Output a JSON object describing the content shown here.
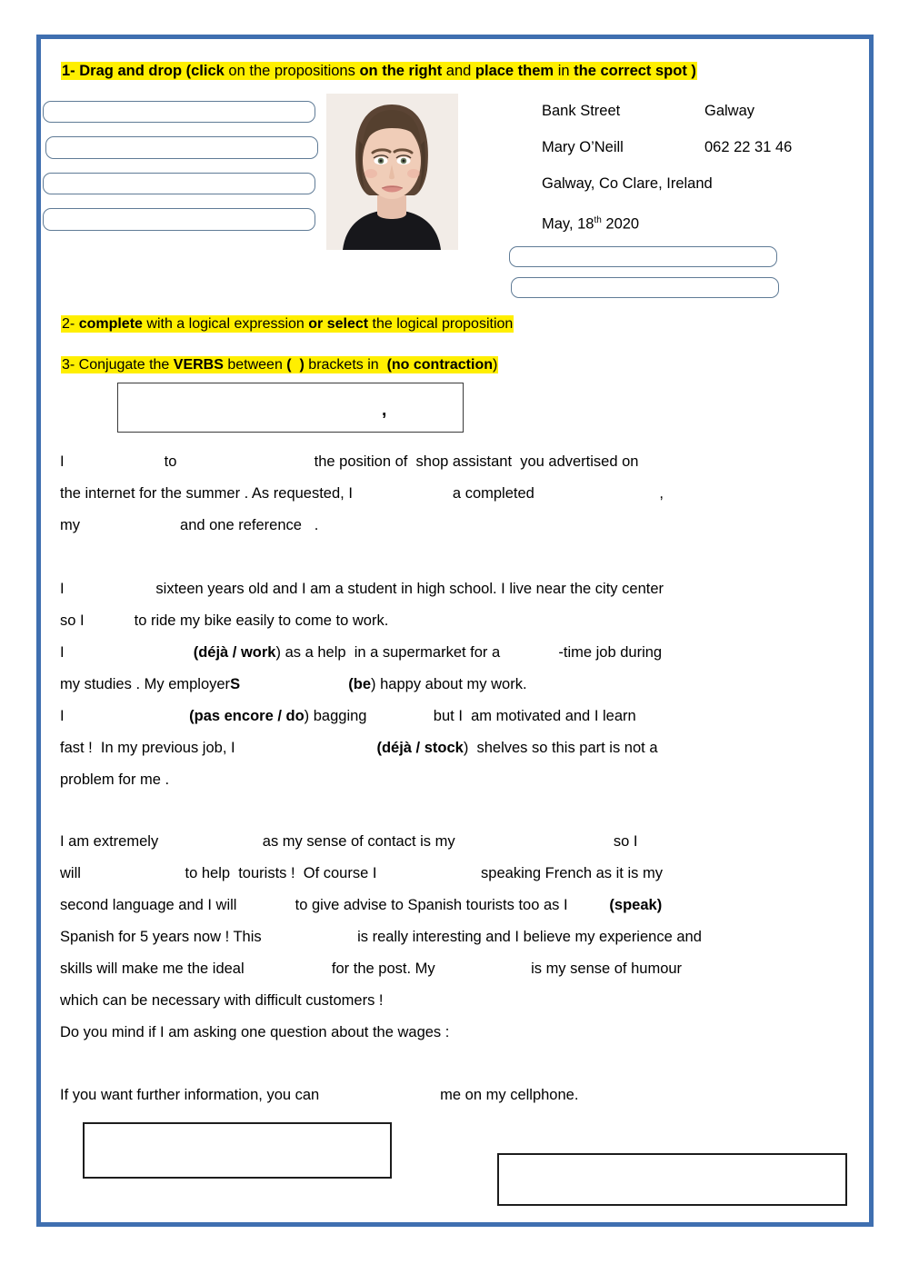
{
  "worksheet": {
    "frame_color": "#3f6fb0",
    "highlight_color": "#ffef00"
  },
  "instructions": {
    "line1": {
      "num": "1-",
      "p1_bold": "Drag and drop",
      "p2_bold": "(click",
      "p3": "on the propositions",
      "p4_bold": "on the right",
      "p5": "and",
      "p6_bold": "place them",
      "p7": "in",
      "p8_bold": "the correct spot )"
    },
    "line2": {
      "num": "2-",
      "p1_bold": "complete",
      "p2": "with a logical expression",
      "p3_bold": "or select",
      "p4": "the logical proposition"
    },
    "line3": {
      "num": "3- Conjugate the",
      "p1_bold": "VERBS",
      "p2": "between",
      "p3_bold": "(",
      "p4_bold": ")",
      "p5": "brackets in",
      "p6_bold": "(no contraction",
      "p7": ")"
    }
  },
  "dropzones": [
    {
      "id": "dz1",
      "value": ""
    },
    {
      "id": "dz2",
      "value": ""
    },
    {
      "id": "dz3",
      "value": ""
    },
    {
      "id": "dz4",
      "value": ""
    },
    {
      "id": "dz5",
      "value": ""
    },
    {
      "id": "dz6",
      "value": ""
    }
  ],
  "photo": {
    "alt": "passport-photo-of-young-woman"
  },
  "address": {
    "street": "Bank Street",
    "city": "Galway",
    "name": "Mary O’Neill",
    "phone": "062 22 31 46",
    "full_location": "Galway, Co Clare, Ireland",
    "date_prefix": "May, 18",
    "date_sup": "th",
    "date_year": " 2020"
  },
  "greeting": {
    "comma": ","
  },
  "letter": {
    "para1": [
      "I                        to                                 the position of  shop assistant  you advertised on",
      "the internet for the summer . As requested, I                        a completed                              ,",
      "my                        and one reference   ."
    ],
    "para2_line1": "I                      sixteen years old and I am a student in high school. I live near the city center",
    "para2_line2": "so I            to ride my bike easily to come to work.",
    "para2_line3_a": "I                               ",
    "para2_line3_cue": "(déjà / work",
    "para2_line3_b": ") as a help  in a supermarket for a              -time job during",
    "para2_line4_a": "my studies . My employer",
    "para2_line4_bold": "S",
    "para2_line4_b": "                          ",
    "para2_line4_cue": "(be",
    "para2_line4_c": ") happy about my work.",
    "para2_line5_a": "I                              ",
    "para2_line5_cue": "(pas encore / do",
    "para2_line5_b": ") bagging                but I  am motivated and I learn",
    "para2_line6_a": "fast !  In my previous job, I                                  ",
    "para2_line6_cue": "(déjà / stock",
    "para2_line6_b": ")  shelves so this part is not a",
    "para2_line7": "problem for me .",
    "para3_line1": "I am extremely                         as my sense of contact is my                                      so I",
    "para3_line2": "will                         to help  tourists !  Of course I                         speaking French as it is my",
    "para3_line3_a": "second language and I will              to give advise to Spanish tourists too as I          ",
    "para3_line3_cue": "(speak)",
    "para3_line4": "Spanish for 5 years now ! This                       is really interesting and I believe my experience and",
    "para3_line5": "skills will make me the ideal                     for the post. My                       is my sense of humour",
    "para3_line6": "which can be necessary with difficult customers !",
    "para3_line7": "Do you mind if I am asking one question about the wages :",
    "para4_line1": "If you want further information, you can                             me on my cellphone."
  },
  "answer_boxes": [
    {
      "id": "ab1",
      "value": ""
    },
    {
      "id": "ab2",
      "value": ""
    }
  ]
}
